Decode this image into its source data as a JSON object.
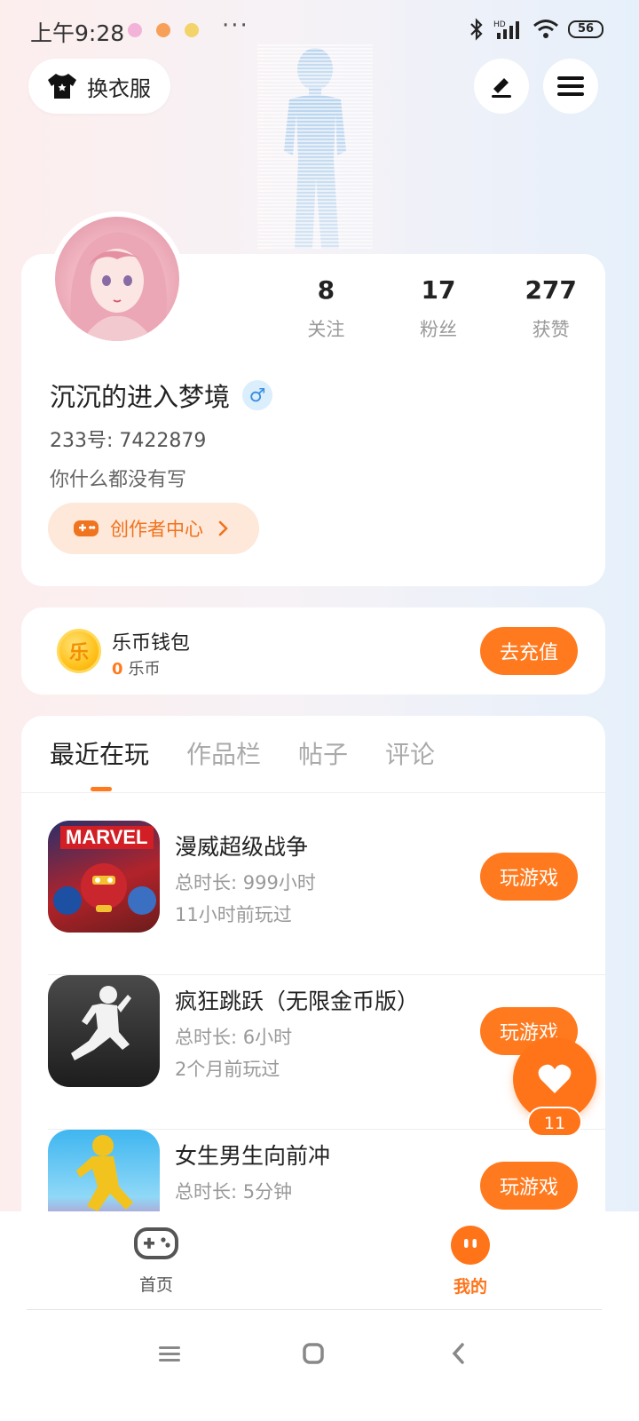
{
  "status_bar": {
    "time": "上午9:28",
    "dots": "···",
    "battery": "56"
  },
  "header": {
    "wardrobe_label": "换衣服",
    "edit_icon": "edit-icon",
    "menu_icon": "menu-icon"
  },
  "profile": {
    "stats": [
      {
        "value": "8",
        "label": "关注"
      },
      {
        "value": "17",
        "label": "粉丝"
      },
      {
        "value": "277",
        "label": "获赞"
      }
    ],
    "username": "沉沉的进入梦境",
    "gender_symbol": "♂",
    "uid": "233号: 7422879",
    "bio": "你什么都没有写",
    "creator_label": "创作者中心"
  },
  "wallet": {
    "coin_glyph": "乐",
    "title": "乐币钱包",
    "amount": "0",
    "unit": "乐币",
    "recharge_label": "去充值"
  },
  "tabs": [
    {
      "label": "最近在玩",
      "active": true
    },
    {
      "label": "作品栏",
      "active": false
    },
    {
      "label": "帖子",
      "active": false
    },
    {
      "label": "评论",
      "active": false
    }
  ],
  "games": [
    {
      "name": "漫威超级战争",
      "duration": "总时长: 999小时",
      "last_played": "11小时前玩过",
      "button": "玩游戏",
      "icon_text": "MARVEL"
    },
    {
      "name": "疯狂跳跃（无限金币版）",
      "duration": "总时长: 6小时",
      "last_played": "2个月前玩过",
      "button": "玩游戏"
    },
    {
      "name": "女生男生向前冲",
      "duration": "总时长: 5分钟",
      "last_played": "",
      "button": "玩游戏"
    }
  ],
  "like_fab": {
    "count": "11"
  },
  "bottom_nav": {
    "home_label": "首页",
    "mine_label": "我的"
  },
  "colors": {
    "accent": "#ff7a1e",
    "male_badge": "#3a8de0"
  }
}
